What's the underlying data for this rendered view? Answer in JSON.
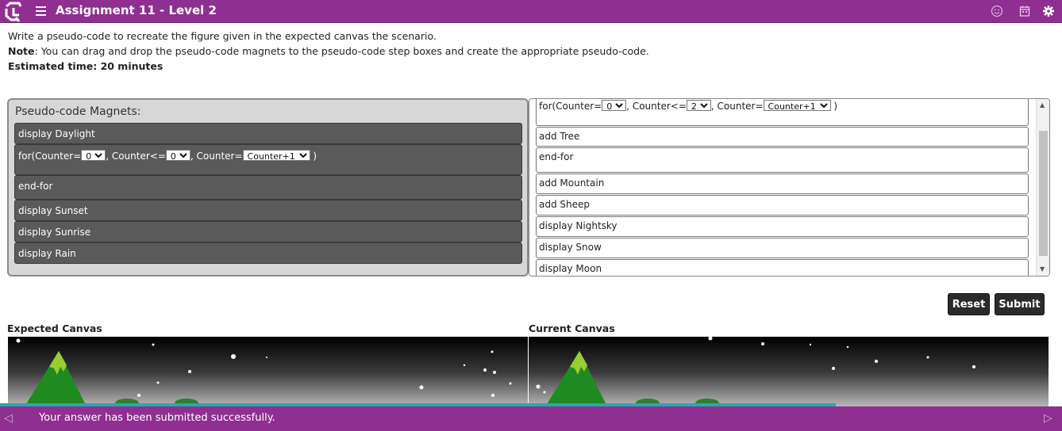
{
  "header": {
    "title": "Assignment 11 - Level 2",
    "icons": [
      "smiley-icon",
      "calendar-icon",
      "settings-gear-icon"
    ]
  },
  "instructions": {
    "line1": "Write a pseudo-code to recreate the figure given in the expected canvas the scenario.",
    "note_label": "Note",
    "note_text": ": You can drag and drop the pseudo-code magnets to the pseudo-code step boxes and create the appropriate pseudo-code.",
    "time": "Estimated time: 20 minutes"
  },
  "magnets": {
    "title": "Pseudo-code Magnets:",
    "display_daylight": "display Daylight",
    "for_loop": {
      "prefix": "for(Counter=",
      "init_value": "0",
      "cond_label": ", Counter<=",
      "cond_value": "0",
      "incr_label": ", Counter=",
      "incr_value": "Counter+1",
      "suffix": " )"
    },
    "end_for": "end-for",
    "display_sunset": "display Sunset",
    "display_sunrise": "display Sunrise",
    "display_rain": "display Rain"
  },
  "steps": {
    "for_loop": {
      "prefix": "for(Counter=",
      "init_value": "0",
      "cond_label": ", Counter<=",
      "cond_value": "2",
      "incr_label": ", Counter=",
      "incr_value": "Counter+1",
      "suffix": " )"
    },
    "add_tree": "add Tree",
    "end_for": "end-for",
    "add_mountain": "add Mountain",
    "add_sheep": "add Sheep",
    "display_nightsky": "display Nightsky",
    "display_snow": "display Snow",
    "display_moon": "display Moon"
  },
  "buttons": {
    "reset": "Reset",
    "submit": "Submit"
  },
  "canvases": {
    "expected_label": "Expected Canvas",
    "current_label": "Current Canvas"
  },
  "footer": {
    "status": "Your answer has been submitted successfully.",
    "progress": 0.787
  },
  "colors": {
    "brand": "#8f2f92",
    "progress": "#2aa7b0",
    "magnet": "#5a5a5a"
  }
}
